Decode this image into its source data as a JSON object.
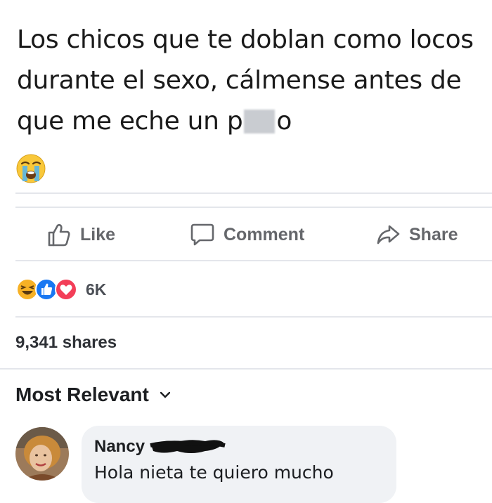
{
  "post": {
    "text_line1": "Los chicos que te doblan como locos",
    "text_line2": "durante el sexo, cálmense antes de",
    "text_line3_before": "que me eche un p",
    "text_line3_after": "o",
    "emoji": "loudly-crying-face"
  },
  "actions": {
    "like_label": "Like",
    "comment_label": "Comment",
    "share_label": "Share"
  },
  "reactions": {
    "icons": [
      "haha-icon",
      "like-icon",
      "love-icon"
    ],
    "count": "6K"
  },
  "shares": {
    "text": "9,341 shares"
  },
  "comments_sort": {
    "label": "Most Relevant"
  },
  "comment": {
    "author": "Nancy",
    "text": "Hola nieta te quiero mucho"
  },
  "colors": {
    "action_gray": "#65676b",
    "bubble_bg": "#f0f2f5",
    "like_blue": "#1877f2",
    "love_red": "#f33e58",
    "haha_yellow": "#f7b125"
  }
}
